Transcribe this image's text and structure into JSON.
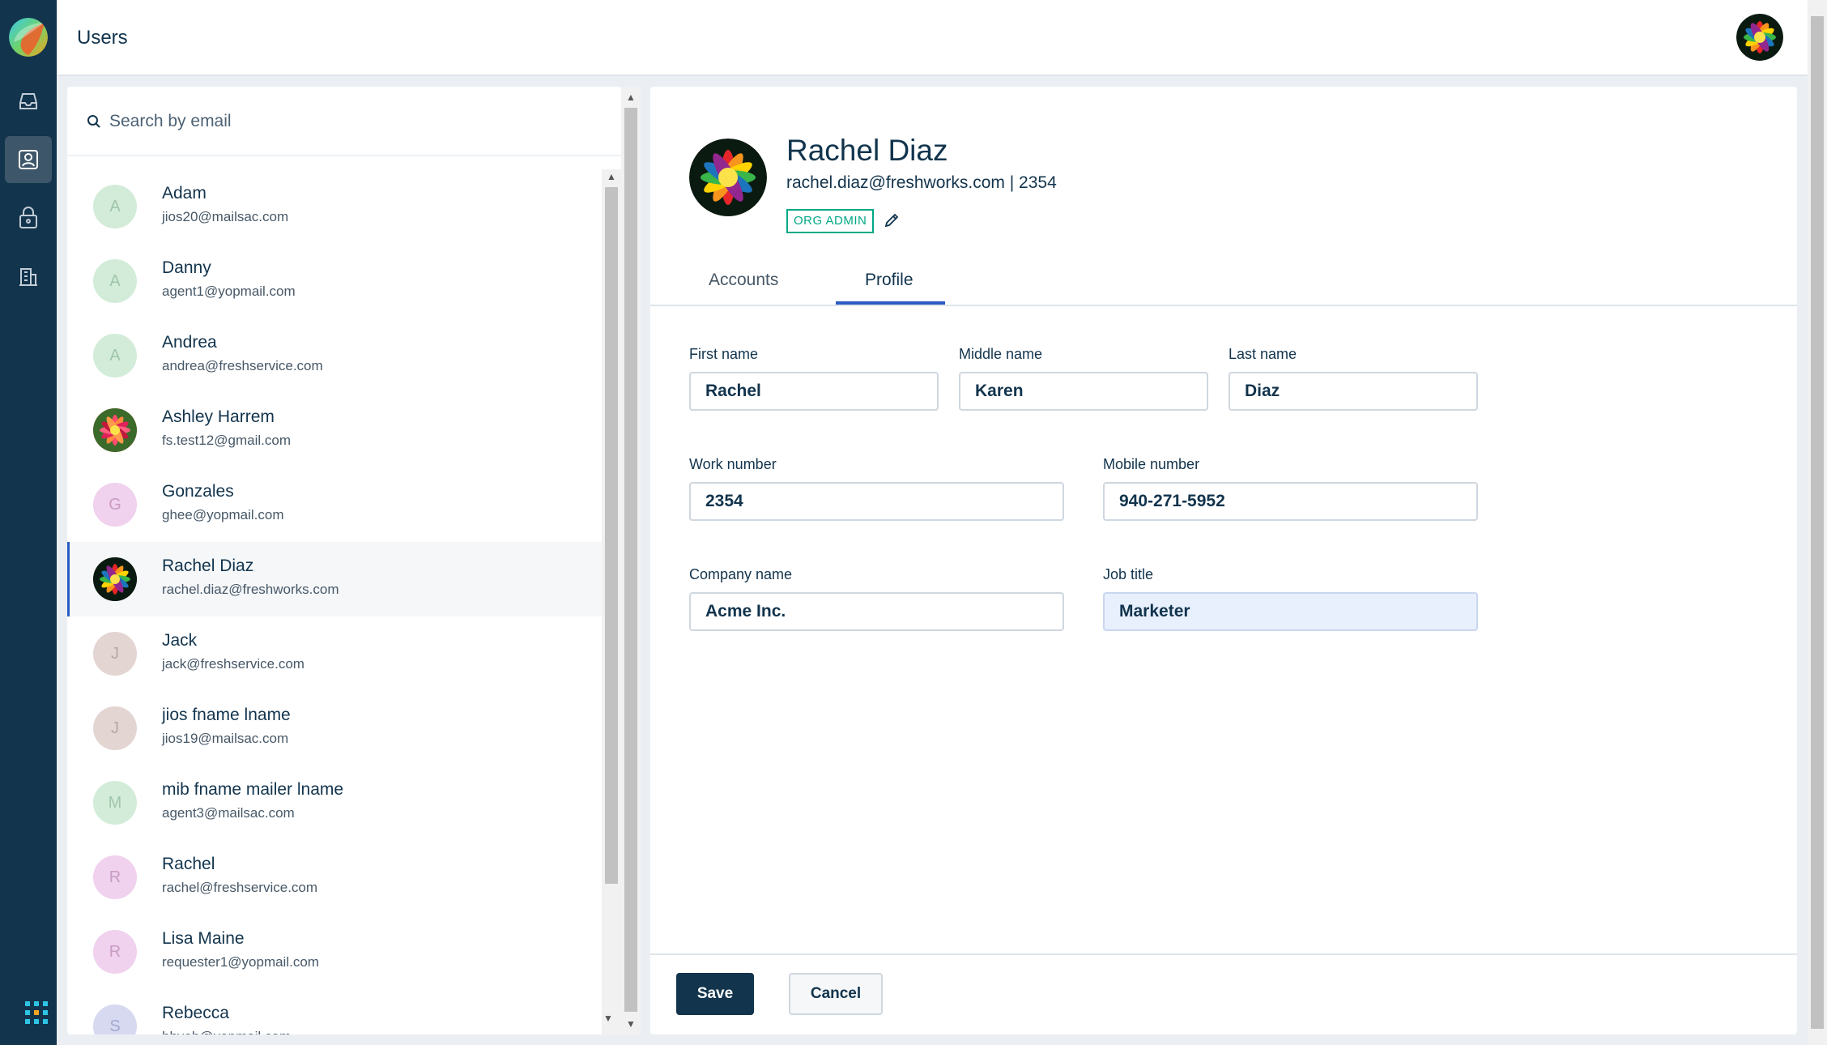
{
  "header": {
    "title": "Users"
  },
  "nav": {
    "items": [
      {
        "icon": "inbox-icon",
        "active": false
      },
      {
        "icon": "contact-card-icon",
        "active": true
      },
      {
        "icon": "lock-icon",
        "active": false
      },
      {
        "icon": "building-icon",
        "active": false
      }
    ],
    "apps_icon": "apps-grid-icon"
  },
  "search": {
    "placeholder": "Search by email",
    "value": ""
  },
  "users": [
    {
      "name": "Adam",
      "email": "jios20@mailsac.com",
      "initial": "A",
      "color": "#d3ecd9",
      "text_color": "#9fc6aa",
      "photo": false
    },
    {
      "name": "Danny",
      "email": "agent1@yopmail.com",
      "initial": "A",
      "color": "#d3ecd9",
      "text_color": "#9fc6aa",
      "photo": false
    },
    {
      "name": "Andrea",
      "email": "andrea@freshservice.com",
      "initial": "A",
      "color": "#d3ecd9",
      "text_color": "#9fc6aa",
      "photo": false
    },
    {
      "name": "Ashley Harrem",
      "email": "fs.test12@gmail.com",
      "initial": "",
      "color": "#c0392b",
      "text_color": "#fff",
      "photo": true
    },
    {
      "name": "Gonzales",
      "email": "ghee@yopmail.com",
      "initial": "G",
      "color": "#f0d1ee",
      "text_color": "#c99cc4",
      "photo": false
    },
    {
      "name": "Rachel Diaz",
      "email": "rachel.diaz@freshworks.com",
      "initial": "",
      "color": "#111",
      "text_color": "#fff",
      "photo": true,
      "selected": true
    },
    {
      "name": "Jack",
      "email": "jack@freshservice.com",
      "initial": "J",
      "color": "#e3d6d2",
      "text_color": "#b8a8a3",
      "photo": false
    },
    {
      "name": "jios fname lname",
      "email": "jios19@mailsac.com",
      "initial": "J",
      "color": "#e3d6d2",
      "text_color": "#b8a8a3",
      "photo": false
    },
    {
      "name": "mib fname mailer lname",
      "email": "agent3@mailsac.com",
      "initial": "M",
      "color": "#d3ecd9",
      "text_color": "#9fc6aa",
      "photo": false
    },
    {
      "name": "Rachel",
      "email": "rachel@freshservice.com",
      "initial": "R",
      "color": "#f0d1ee",
      "text_color": "#c99cc4",
      "photo": false
    },
    {
      "name": "Lisa Maine",
      "email": "requester1@yopmail.com",
      "initial": "R",
      "color": "#f0d1ee",
      "text_color": "#c99cc4",
      "photo": false
    },
    {
      "name": "Rebecca",
      "email": "hhyeh@yopmail.com",
      "initial": "S",
      "color": "#d6d9f0",
      "text_color": "#a2a8cf",
      "photo": false
    }
  ],
  "profile": {
    "name": "Rachel Diaz",
    "subtitle": "rachel.diaz@freshworks.com | 2354",
    "badge": "ORG ADMIN"
  },
  "tabs": [
    {
      "label": "Accounts",
      "active": false
    },
    {
      "label": "Profile",
      "active": true
    }
  ],
  "form": {
    "first_name": {
      "label": "First name",
      "value": "Rachel"
    },
    "middle_name": {
      "label": "Middle name",
      "value": "Karen"
    },
    "last_name": {
      "label": "Last name",
      "value": "Diaz"
    },
    "work_number": {
      "label": "Work number",
      "value": "2354"
    },
    "mobile_number": {
      "label": "Mobile number",
      "value": "940-271-5952"
    },
    "company_name": {
      "label": "Company name",
      "value": "Acme Inc."
    },
    "job_title": {
      "label": "Job title",
      "value": "Marketer"
    }
  },
  "actions": {
    "save_label": "Save",
    "cancel_label": "Cancel"
  },
  "colors": {
    "brand_dark": "#12344d",
    "accent_blue": "#2c5cc5",
    "admin_green": "#00a886"
  }
}
